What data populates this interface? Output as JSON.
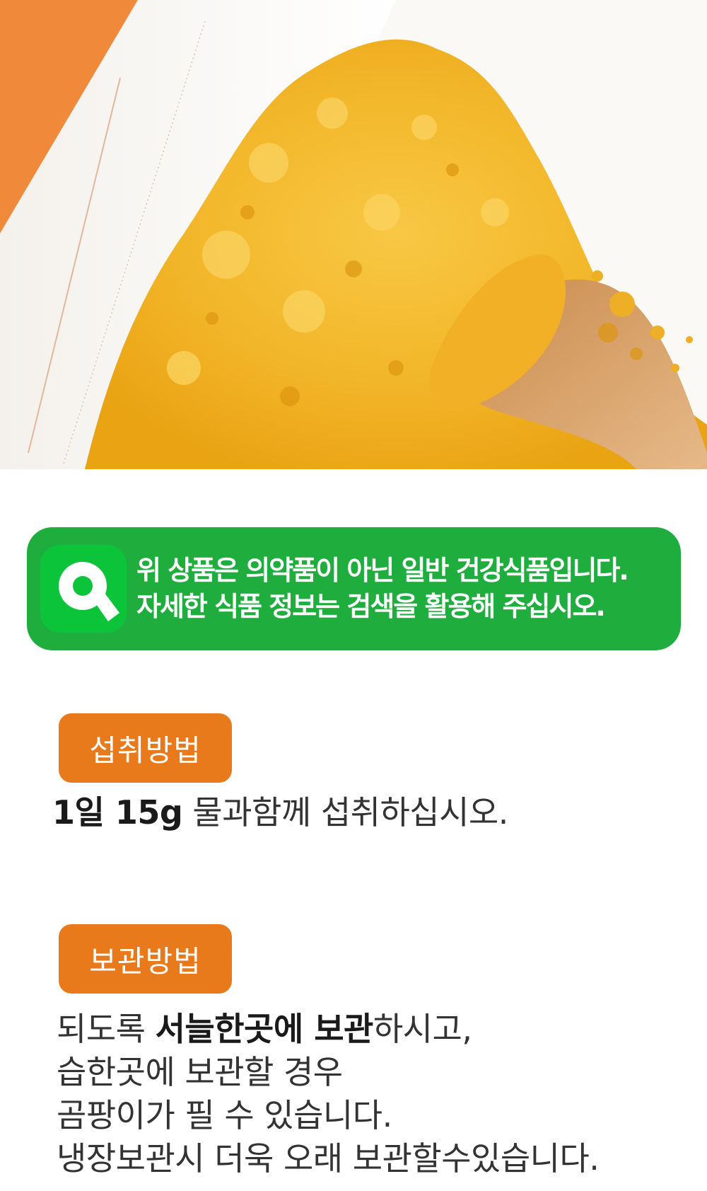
{
  "hero": {
    "image": "product-powder-photo",
    "colors": {
      "powder": "#f2b31f",
      "spoon": "#d9a36a",
      "orange": "#f08a3a"
    }
  },
  "notice": {
    "icon": "search-icon",
    "line1": "위 상품은 의약품이 아닌 일반 건강식품입니다.",
    "line2": "자세한 식품 정보는 검색을 활용해 주십시오.",
    "color": "#1fad3e"
  },
  "intake": {
    "tag": "섭취방법",
    "amount": "1일 15g",
    "rest": " 물과함께 섭취하십시오."
  },
  "storage": {
    "tag": "보관방법",
    "line1_pre": "되도록 ",
    "line1_bold": "서늘한곳에 보관",
    "line1_post": "하시고,",
    "line2": "습한곳에 보관할 경우",
    "line3": "곰팡이가 필 수 있습니다.",
    "line4": "냉장보관시 더욱 오래 보관할수있습니다."
  },
  "accent_color": "#e97a1b"
}
